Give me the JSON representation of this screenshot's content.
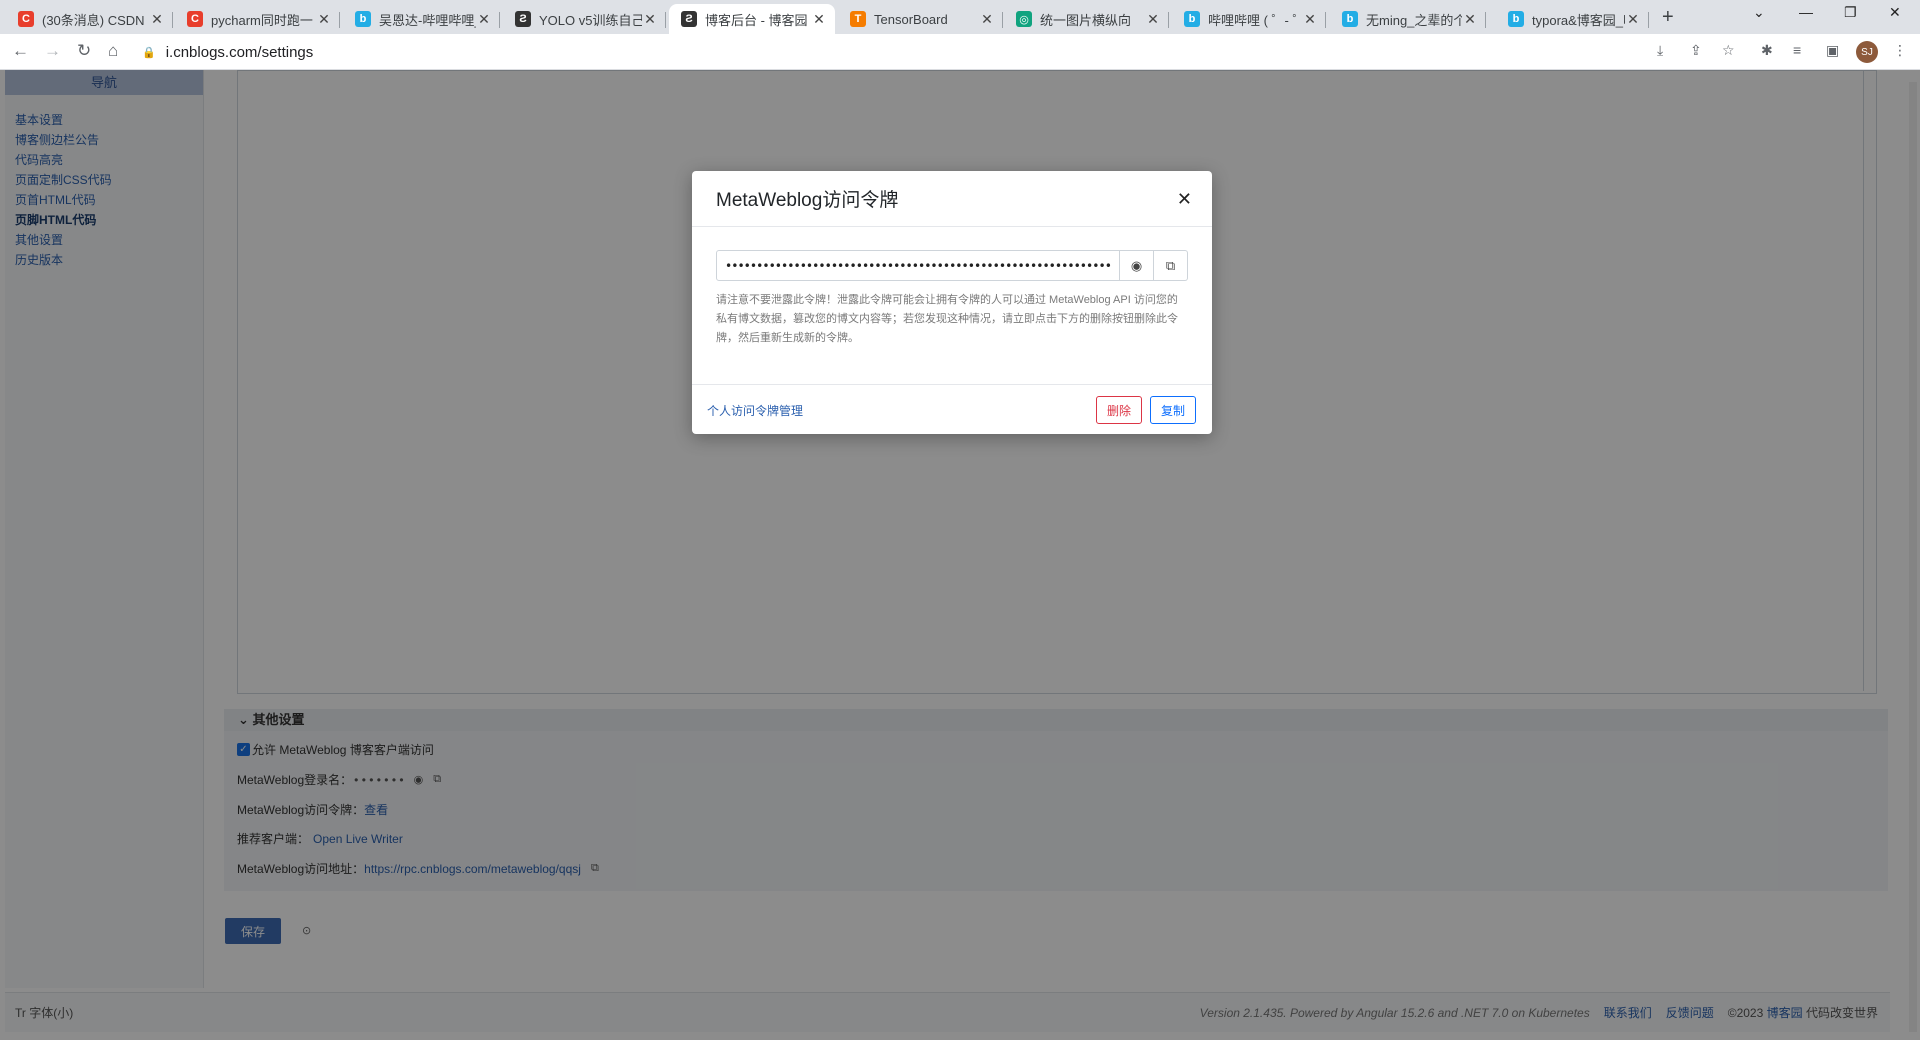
{
  "browser": {
    "tabs": [
      {
        "title": "(30条消息) CSDN",
        "icon": "csdn-icon",
        "color": "#e83e2c",
        "glyph": "C"
      },
      {
        "title": "pycharm同时跑一",
        "icon": "csdn-icon",
        "color": "#e83e2c",
        "glyph": "C"
      },
      {
        "title": "吴恩达-哔哩哔哩_b",
        "icon": "bilibili-icon",
        "color": "#23ade5",
        "glyph": "b"
      },
      {
        "title": "YOLO v5训练自己",
        "icon": "cnblogs-icon",
        "color": "#333333",
        "glyph": "Ƨ"
      },
      {
        "title": "博客后台 - 博客园",
        "icon": "cnblogs-icon",
        "color": "#333333",
        "glyph": "Ƨ"
      },
      {
        "title": "TensorBoard",
        "icon": "tensorboard-icon",
        "color": "#f57c00",
        "glyph": "T"
      },
      {
        "title": "统一图片横纵向",
        "icon": "chatgpt-icon",
        "color": "#10a37f",
        "glyph": "◎"
      },
      {
        "title": "哔哩哔哩 ( ゜- ゜)つ",
        "icon": "bilibili-icon",
        "color": "#23ade5",
        "glyph": "b"
      },
      {
        "title": "无ming_之辈的个人",
        "icon": "bilibili-icon",
        "color": "#23ade5",
        "glyph": "b"
      },
      {
        "title": "typora&博客园_哔",
        "icon": "bilibili-icon",
        "color": "#23ade5",
        "glyph": "b"
      }
    ],
    "active_tab": 4,
    "url": "i.cnblogs.com/settings",
    "avatar_text": "SJ"
  },
  "sidebar": {
    "header": "导航",
    "items": [
      "基本设置",
      "博客侧边栏公告",
      "代码高亮",
      "页面定制CSS代码",
      "页首HTML代码",
      "页脚HTML代码",
      "其他设置",
      "历史版本"
    ],
    "active_index": 5
  },
  "settings": {
    "section_title": "其他设置",
    "allow_label": "允许 MetaWeblog 博客客户端访问",
    "allow_checked": true,
    "login_label": "MetaWeblog登录名：",
    "login_masked": "• • • • • • •",
    "token_label": "MetaWeblog访问令牌：",
    "token_view": "查看",
    "client_label": "推荐客户端：",
    "client_link": "Open Live Writer",
    "address_label": "MetaWeblog访问地址：",
    "address_link": "https://rpc.cnblogs.com/metaweblog/qqsj",
    "save_label": "保存"
  },
  "footer": {
    "font_toggle": "Tr 字体(小)",
    "version": "Version 2.1.435. Powered by Angular 15.2.6 and .NET 7.0 on Kubernetes",
    "contact": "联系我们",
    "feedback": "反馈问题",
    "copyright": "©2023",
    "brand": "博客园",
    "slogan": "代码改变世界"
  },
  "modal": {
    "title": "MetaWeblog访问令牌",
    "token_masked": "••••••••••••••••••••••••••••••••••••••••••••••••••••••••••••••••••••••",
    "warning": "请注意不要泄露此令牌！泄露此令牌可能会让拥有令牌的人可以通过 MetaWeblog API 访问您的私有博文数据，篡改您的博文内容等；若您发现这种情况，请立即点击下方的删除按钮删除此令牌，然后重新生成新的令牌。",
    "manage_link": "个人访问令牌管理",
    "delete_label": "删除",
    "copy_label": "复制"
  }
}
